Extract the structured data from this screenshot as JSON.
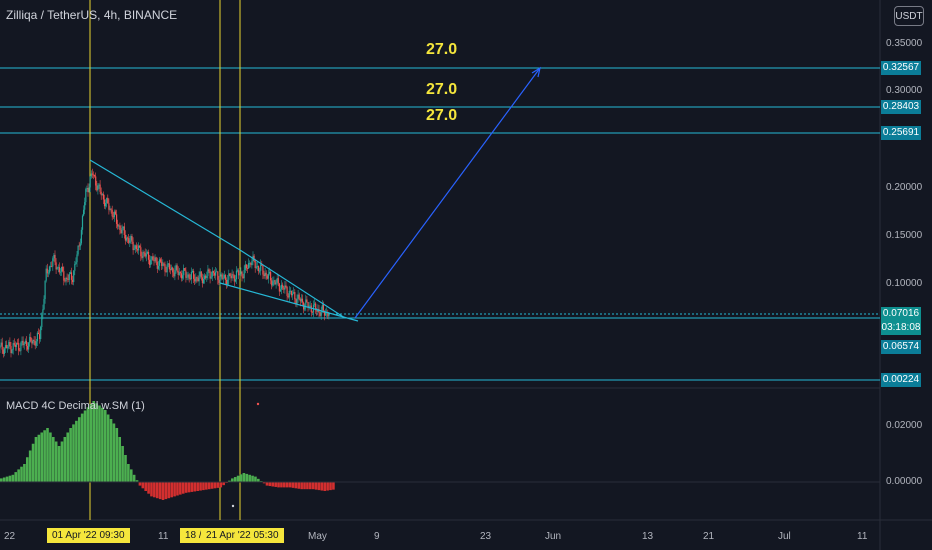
{
  "header": {
    "symbol_title": "Zilliqa / TetherUS, 4h, BINANCE",
    "currency_button": "USDT"
  },
  "indicator": {
    "title": "MACD 4C Decimal w.SM (1)",
    "axis_labels": [
      "0.02000",
      "0.00000"
    ]
  },
  "price_axis": {
    "labels": [
      "0.35000",
      "0.30000",
      "0.20000",
      "0.15000",
      "0.10000"
    ],
    "level_tags": [
      "0.32567",
      "0.28403",
      "0.25691",
      "0.06574",
      "0.00224"
    ],
    "current_price": "0.07016",
    "countdown": "03:18:08"
  },
  "annotations": {
    "targets": [
      "27.0",
      "27.0",
      "27.0"
    ]
  },
  "time_axis": {
    "labels": [
      "22",
      "11",
      "May",
      "9",
      "23",
      "Jun",
      "13",
      "21",
      "Jul",
      "11"
    ],
    "highlighted": [
      "01 Apr '22  09:30",
      "18 /",
      "21 Apr '22  05:30"
    ]
  },
  "colors": {
    "background": "#131722",
    "level_line": "#26b8d6",
    "vertical_marker": "#e8d430",
    "trend_arrow": "#2962ff",
    "candle_up": "#26a69a",
    "candle_down": "#ef5350",
    "macd_green": "#4caf50",
    "macd_red": "#d32f2f"
  },
  "chart_data": {
    "type": "candlestick",
    "series": [
      {
        "name": "Zilliqa / TetherUS",
        "close_path": [
          [
            0.033,
            0.034,
            0.035,
            0.036,
            0.038,
            0.04,
            0.045,
            0.11,
            0.125,
            0.115,
            0.105,
            0.108,
            0.14,
            0.195,
            0.215,
            0.198,
            0.185,
            0.175,
            0.16,
            0.15,
            0.142,
            0.135,
            0.13,
            0.125,
            0.122,
            0.118,
            0.115,
            0.112,
            0.11,
            0.108,
            0.106,
            0.107,
            0.112,
            0.108,
            0.105,
            0.107,
            0.11,
            0.112,
            0.125,
            0.118,
            0.112,
            0.105,
            0.1,
            0.095,
            0.09,
            0.085,
            0.08,
            0.076,
            0.073,
            0.071,
            0.07
          ]
        ]
      }
    ],
    "macd_histogram": [
      0.002,
      0.004,
      0.01,
      0.025,
      0.03,
      0.02,
      0.03,
      0.038,
      0.045,
      0.04,
      0.03,
      0.01,
      -0.002,
      -0.008,
      -0.01,
      -0.008,
      -0.006,
      -0.005,
      -0.004,
      -0.003,
      0.002,
      0.005,
      0.003,
      -0.002,
      -0.003,
      -0.003,
      -0.004,
      -0.004,
      -0.005,
      -0.004
    ]
  }
}
